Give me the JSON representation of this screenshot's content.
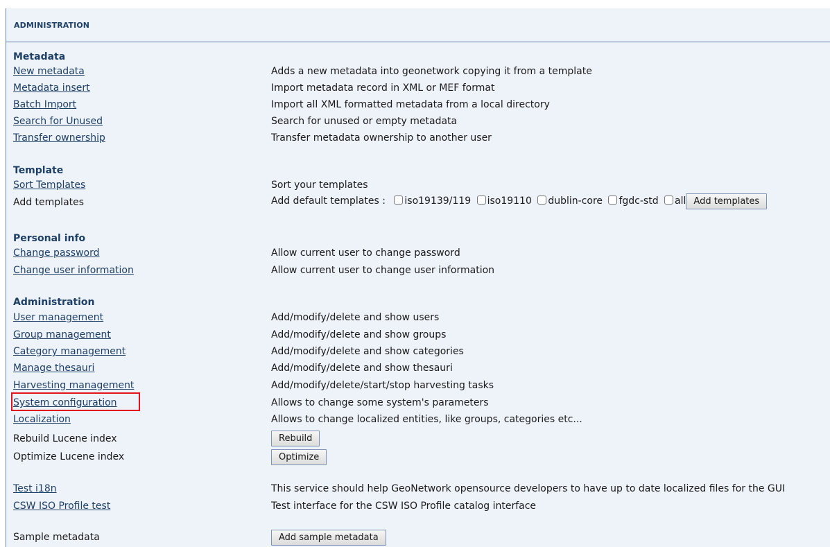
{
  "header": {
    "title": "ADMINISTRATION"
  },
  "sections": {
    "metadata": {
      "title": "Metadata",
      "rows": [
        {
          "label": "New metadata",
          "desc": "Adds a new metadata into geonetwork copying it from a template"
        },
        {
          "label": "Metadata insert",
          "desc": "Import metadata record in XML or MEF format"
        },
        {
          "label": "Batch Import",
          "desc": "Import all XML formatted metadata from a local directory"
        },
        {
          "label": "Search for Unused",
          "desc": "Search for unused or empty metadata"
        },
        {
          "label": "Transfer ownership",
          "desc": "Transfer metadata ownership to another user"
        }
      ]
    },
    "template": {
      "title": "Template",
      "sort": {
        "label": "Sort Templates",
        "desc": "Sort your templates"
      },
      "add": {
        "label": "Add templates",
        "prefix": "Add default templates :",
        "options": [
          "iso19139/119",
          "iso19110",
          "dublin-core",
          "fgdc-std",
          "all"
        ],
        "button": "Add templates"
      }
    },
    "personal": {
      "title": "Personal info",
      "rows": [
        {
          "label": "Change password",
          "desc": "Allow current user to change password"
        },
        {
          "label": "Change user information",
          "desc": "Allow current user to change user information"
        }
      ]
    },
    "administration": {
      "title": "Administration",
      "rows": [
        {
          "label": "User management",
          "desc": "Add/modify/delete and show users"
        },
        {
          "label": "Group management",
          "desc": "Add/modify/delete and show groups"
        },
        {
          "label": "Category management",
          "desc": "Add/modify/delete and show categories"
        },
        {
          "label": "Manage thesauri",
          "desc": "Add/modify/delete and show thesauri"
        },
        {
          "label": "Harvesting management",
          "desc": "Add/modify/delete/start/stop harvesting tasks"
        },
        {
          "label": "System configuration",
          "desc": "Allows to change some system's parameters"
        },
        {
          "label": "Localization",
          "desc": "Allows to change localized entities, like groups, categories etc..."
        }
      ],
      "rebuild": {
        "label": "Rebuild Lucene index",
        "button": "Rebuild"
      },
      "optimize": {
        "label": "Optimize Lucene index",
        "button": "Optimize"
      }
    },
    "testing": {
      "rows": [
        {
          "label": "Test i18n",
          "desc": "This service should help GeoNetwork opensource developers to have up to date localized files for the GUI"
        },
        {
          "label": "CSW ISO Profile test",
          "desc": "Test interface for the CSW ISO Profile catalog interface"
        }
      ]
    },
    "sample": {
      "label": "Sample metadata",
      "button": "Add sample metadata"
    }
  },
  "colors": {
    "panel_bg": "#eef3f9",
    "heading": "#1e3f66",
    "highlight": "#e3121b"
  }
}
